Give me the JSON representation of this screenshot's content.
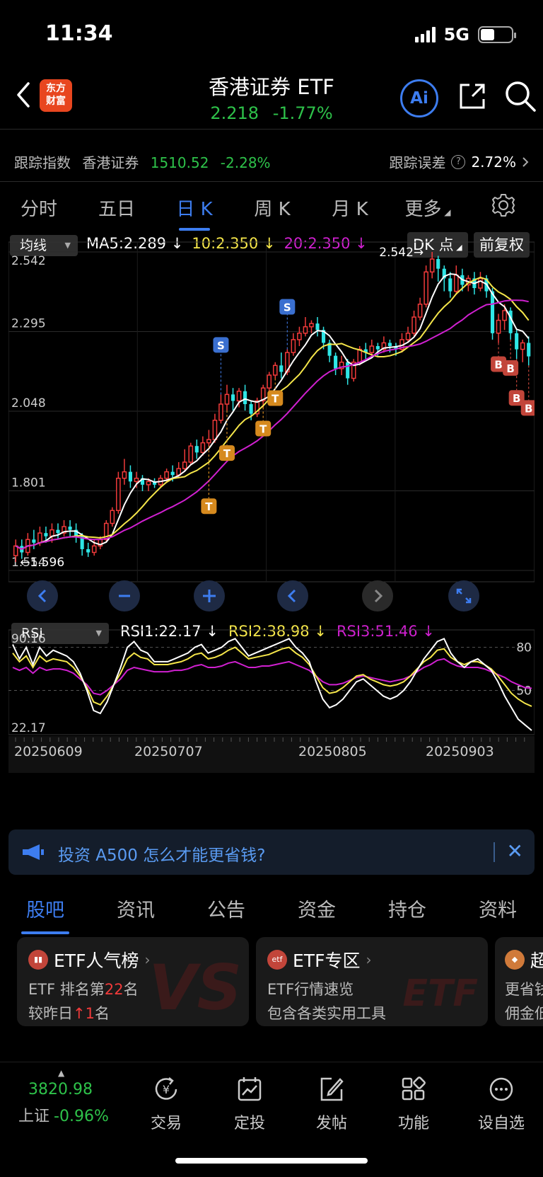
{
  "status": {
    "time": "11:34",
    "network": "5G"
  },
  "header": {
    "logo_line1": "东方",
    "logo_line2": "财富",
    "title": "香港证券 ETF",
    "price": "2.218",
    "change_pct": "-1.77%",
    "ai_label": "Ai"
  },
  "tracking": {
    "label": "跟踪指数",
    "index_name": "香港证券",
    "index_value": "1510.52",
    "index_change": "-2.28%",
    "error_label": "跟踪误差",
    "error_value": "2.72%"
  },
  "period_tabs": [
    "分时",
    "五日",
    "日 K",
    "周 K",
    "月 K",
    "更多"
  ],
  "active_period_index": 2,
  "overlay": {
    "indicator_select": "均线",
    "ma5": "MA5:2.289",
    "ma10": "10:2.350",
    "ma20": "20:2.350",
    "dk_label": "DK 点",
    "adjust_label": "前复权",
    "arrow_down": "↓"
  },
  "rsi_bar": {
    "indicator_select": "RSI",
    "rsi1": "RSI1:22.17",
    "rsi2": "RSI2:38.98",
    "rsi3": "RSI3:51.46"
  },
  "colors": {
    "up": "#f03a3a",
    "down": "#2ee6e6",
    "ma5": "#ffffff",
    "ma10": "#f5e64a",
    "ma20": "#d020d0",
    "accent": "#3d7df0"
  },
  "chart_data": [
    {
      "type": "candlestick",
      "title": "",
      "y_ticks": [
        "2.542",
        "2.295",
        "2.048",
        "1.801",
        "1.554"
      ],
      "ylim": [
        1.554,
        2.542
      ],
      "annotations": {
        "high_label": "2.542",
        "low_label": "1.596"
      },
      "markers": {
        "S": "S",
        "T": "T",
        "B": "B"
      },
      "x_labels": [
        "20250609",
        "20250707",
        "20250805",
        "20250903"
      ],
      "candles": [
        [
          1.6,
          1.63,
          1.58,
          1.65
        ],
        [
          1.63,
          1.61,
          1.59,
          1.65
        ],
        [
          1.61,
          1.65,
          1.6,
          1.67
        ],
        [
          1.65,
          1.64,
          1.62,
          1.68
        ],
        [
          1.64,
          1.67,
          1.63,
          1.69
        ],
        [
          1.67,
          1.66,
          1.64,
          1.69
        ],
        [
          1.66,
          1.68,
          1.64,
          1.7
        ],
        [
          1.68,
          1.67,
          1.65,
          1.7
        ],
        [
          1.67,
          1.69,
          1.66,
          1.71
        ],
        [
          1.69,
          1.68,
          1.66,
          1.71
        ],
        [
          1.68,
          1.66,
          1.64,
          1.7
        ],
        [
          1.66,
          1.62,
          1.6,
          1.67
        ],
        [
          1.62,
          1.61,
          1.596,
          1.64
        ],
        [
          1.61,
          1.63,
          1.6,
          1.65
        ],
        [
          1.63,
          1.65,
          1.62,
          1.66
        ],
        [
          1.65,
          1.7,
          1.64,
          1.71
        ],
        [
          1.7,
          1.74,
          1.69,
          1.75
        ],
        [
          1.74,
          1.84,
          1.73,
          1.86
        ],
        [
          1.84,
          1.86,
          1.82,
          1.9
        ],
        [
          1.86,
          1.83,
          1.81,
          1.88
        ],
        [
          1.83,
          1.84,
          1.81,
          1.86
        ],
        [
          1.84,
          1.82,
          1.8,
          1.85
        ],
        [
          1.82,
          1.83,
          1.8,
          1.84
        ],
        [
          1.83,
          1.82,
          1.81,
          1.84
        ],
        [
          1.82,
          1.84,
          1.81,
          1.85
        ],
        [
          1.84,
          1.86,
          1.83,
          1.87
        ],
        [
          1.86,
          1.85,
          1.83,
          1.88
        ],
        [
          1.85,
          1.87,
          1.84,
          1.89
        ],
        [
          1.87,
          1.89,
          1.86,
          1.93
        ],
        [
          1.89,
          1.94,
          1.88,
          1.95
        ],
        [
          1.94,
          1.92,
          1.9,
          1.96
        ],
        [
          1.92,
          1.95,
          1.91,
          1.97
        ],
        [
          1.95,
          1.96,
          1.94,
          1.99
        ],
        [
          1.96,
          2.02,
          1.95,
          2.04
        ],
        [
          2.02,
          2.07,
          2.01,
          2.1
        ],
        [
          2.07,
          2.1,
          2.05,
          2.13
        ],
        [
          2.1,
          2.08,
          2.05,
          2.12
        ],
        [
          2.08,
          2.11,
          2.06,
          2.12
        ],
        [
          2.11,
          2.07,
          2.05,
          2.13
        ],
        [
          2.07,
          2.04,
          2.02,
          2.08
        ],
        [
          2.04,
          2.08,
          2.03,
          2.09
        ],
        [
          2.08,
          2.12,
          2.06,
          2.13
        ],
        [
          2.12,
          2.16,
          2.11,
          2.17
        ],
        [
          2.16,
          2.19,
          2.15,
          2.2
        ],
        [
          2.19,
          2.17,
          2.15,
          2.23
        ],
        [
          2.17,
          2.23,
          2.16,
          2.24
        ],
        [
          2.23,
          2.27,
          2.22,
          2.29
        ],
        [
          2.27,
          2.29,
          2.25,
          2.31
        ],
        [
          2.29,
          2.31,
          2.28,
          2.34
        ],
        [
          2.31,
          2.32,
          2.29,
          2.33
        ],
        [
          2.32,
          2.3,
          2.28,
          2.34
        ],
        [
          2.3,
          2.26,
          2.24,
          2.31
        ],
        [
          2.26,
          2.22,
          2.2,
          2.27
        ],
        [
          2.22,
          2.18,
          2.16,
          2.23
        ],
        [
          2.18,
          2.2,
          2.16,
          2.22
        ],
        [
          2.2,
          2.15,
          2.13,
          2.21
        ],
        [
          2.15,
          2.2,
          2.14,
          2.21
        ],
        [
          2.2,
          2.24,
          2.19,
          2.25
        ],
        [
          2.24,
          2.23,
          2.21,
          2.26
        ],
        [
          2.23,
          2.25,
          2.22,
          2.27
        ],
        [
          2.25,
          2.24,
          2.22,
          2.26
        ],
        [
          2.24,
          2.26,
          2.23,
          2.28
        ],
        [
          2.26,
          2.25,
          2.23,
          2.27
        ],
        [
          2.25,
          2.24,
          2.22,
          2.26
        ],
        [
          2.24,
          2.27,
          2.23,
          2.29
        ],
        [
          2.27,
          2.29,
          2.26,
          2.31
        ],
        [
          2.29,
          2.34,
          2.28,
          2.36
        ],
        [
          2.34,
          2.38,
          2.33,
          2.4
        ],
        [
          2.38,
          2.48,
          2.37,
          2.5
        ],
        [
          2.48,
          2.52,
          2.46,
          2.542
        ],
        [
          2.52,
          2.49,
          2.45,
          2.53
        ],
        [
          2.49,
          2.46,
          2.42,
          2.5
        ],
        [
          2.46,
          2.42,
          2.4,
          2.48
        ],
        [
          2.42,
          2.47,
          2.41,
          2.5
        ],
        [
          2.47,
          2.44,
          2.42,
          2.49
        ],
        [
          2.44,
          2.46,
          2.42,
          2.47
        ],
        [
          2.46,
          2.43,
          2.41,
          2.48
        ],
        [
          2.43,
          2.46,
          2.42,
          2.48
        ],
        [
          2.46,
          2.42,
          2.4,
          2.47
        ],
        [
          2.42,
          2.29,
          2.27,
          2.43
        ],
        [
          2.29,
          2.33,
          2.26,
          2.35
        ],
        [
          2.33,
          2.36,
          2.3,
          2.38
        ],
        [
          2.36,
          2.29,
          2.27,
          2.37
        ],
        [
          2.29,
          2.24,
          2.21,
          2.3
        ],
        [
          2.24,
          2.26,
          2.2,
          2.27
        ],
        [
          2.26,
          2.218,
          2.19,
          2.28
        ]
      ]
    },
    {
      "type": "line",
      "title": "",
      "y_ticks_left": [
        "90.16",
        "22.17"
      ],
      "y_ticks_right": [
        "80",
        "50"
      ],
      "ylim": [
        22.17,
        90.16
      ],
      "series": [
        {
          "name": "RSI1",
          "values": [
            82,
            72,
            80,
            68,
            80,
            74,
            78,
            76,
            74,
            70,
            62,
            50,
            36,
            34,
            42,
            54,
            66,
            80,
            84,
            78,
            76,
            70,
            70,
            70,
            72,
            74,
            76,
            80,
            82,
            76,
            78,
            80,
            84,
            86,
            80,
            74,
            76,
            78,
            80,
            82,
            84,
            86,
            80,
            76,
            70,
            56,
            44,
            38,
            40,
            44,
            50,
            56,
            58,
            54,
            50,
            46,
            44,
            46,
            50,
            56,
            64,
            72,
            78,
            84,
            86,
            76,
            70,
            66,
            70,
            72,
            68,
            64,
            56,
            46,
            38,
            30,
            26,
            22.17
          ]
        },
        {
          "name": "RSI2",
          "values": [
            76,
            70,
            74,
            66,
            74,
            70,
            72,
            71,
            70,
            66,
            60,
            52,
            42,
            40,
            46,
            54,
            62,
            72,
            76,
            73,
            72,
            68,
            68,
            68,
            69,
            70,
            72,
            75,
            76,
            72,
            73,
            75,
            78,
            80,
            76,
            72,
            73,
            74,
            75,
            77,
            79,
            80,
            76,
            73,
            68,
            60,
            52,
            48,
            49,
            52,
            56,
            60,
            61,
            58,
            56,
            54,
            53,
            54,
            56,
            60,
            65,
            70,
            73,
            78,
            79,
            73,
            70,
            68,
            70,
            70,
            68,
            65,
            60,
            54,
            48,
            44,
            41,
            38.98
          ]
        },
        {
          "name": "RSI3",
          "values": [
            66,
            64,
            66,
            62,
            66,
            64,
            65,
            65,
            64,
            62,
            58,
            54,
            48,
            47,
            50,
            54,
            58,
            64,
            66,
            65,
            64,
            63,
            63,
            63,
            64,
            64,
            65,
            67,
            68,
            66,
            66,
            67,
            69,
            70,
            68,
            66,
            66,
            67,
            67,
            68,
            69,
            70,
            68,
            66,
            64,
            60,
            56,
            54,
            54,
            55,
            57,
            59,
            60,
            59,
            58,
            57,
            56,
            57,
            58,
            60,
            63,
            66,
            68,
            71,
            72,
            69,
            67,
            66,
            66,
            66,
            65,
            63,
            61,
            59,
            56,
            54,
            52,
            51.46
          ]
        }
      ]
    }
  ],
  "ad": {
    "text": "投资 A500 怎么才能更省钱?"
  },
  "content_tabs": [
    "股吧",
    "资讯",
    "公告",
    "资金",
    "持仓",
    "资料"
  ],
  "active_content_index": 0,
  "cards": [
    {
      "title": "ETF人气榜",
      "line1_pre": "ETF 排名第",
      "line1_num": "22",
      "line1_post": "名",
      "line2_pre": "较昨日",
      "line2_arrow": "↑",
      "line2_num": "1",
      "line2_post": "名",
      "watermark": "VS"
    },
    {
      "title": "ETF专区",
      "line1": "ETF行情速览",
      "line2": "包含各类实用工具",
      "watermark": "ETF"
    },
    {
      "title": "超",
      "line1": "更省钱",
      "line2": "佣金低"
    }
  ],
  "bottom_nav": {
    "index_value": "3820.98",
    "index_name": "上证",
    "index_change": "-0.96%",
    "items": [
      "交易",
      "定投",
      "发帖",
      "功能",
      "设自选"
    ]
  }
}
